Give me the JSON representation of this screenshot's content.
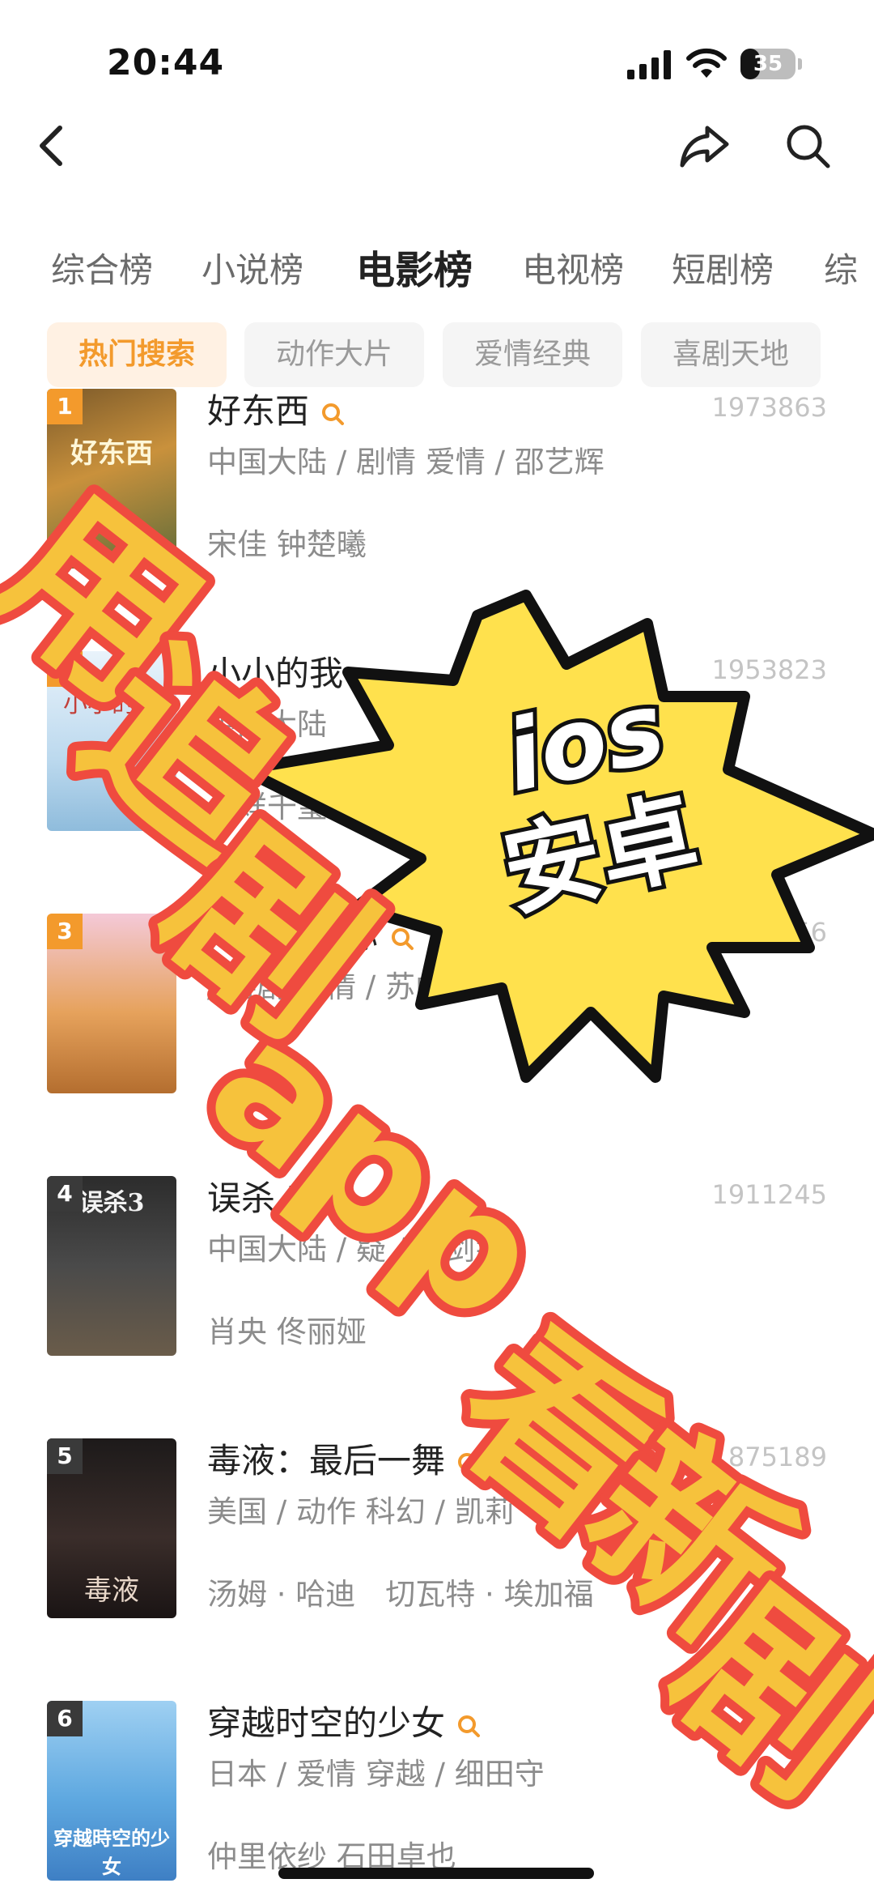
{
  "status_bar": {
    "time": "20:44",
    "battery": "35",
    "battery_level": 0.35
  },
  "nav": {
    "back_icon": "chevron-left-icon",
    "share_icon": "share-icon",
    "search_icon": "search-icon"
  },
  "tabs": [
    {
      "label": "综合榜",
      "active": false
    },
    {
      "label": "小说榜",
      "active": false
    },
    {
      "label": "电影榜",
      "active": true
    },
    {
      "label": "电视榜",
      "active": false
    },
    {
      "label": "短剧榜",
      "active": false
    },
    {
      "label": "综",
      "active": false
    }
  ],
  "chips": [
    {
      "label": "热门搜索",
      "active": true
    },
    {
      "label": "动作大片",
      "active": false
    },
    {
      "label": "爱情经典",
      "active": false
    },
    {
      "label": "喜剧天地",
      "active": false
    }
  ],
  "movies": [
    {
      "rank": "1",
      "title": "好东西",
      "score": "1973863",
      "meta": "中国大陆 / 剧情 爱情 / 邵艺辉",
      "cast": "宋佳 钟楚曦",
      "poster_text": "好东西"
    },
    {
      "rank": "2",
      "title": "小小的我",
      "score": "1953823",
      "meta": "中国大陆",
      "cast": "易烊千玺",
      "poster_text": "小小的我"
    },
    {
      "rank": "3",
      "title": "“骗”喜欢你",
      "score": "556",
      "meta": "/ 喜剧 爱情 / 苏彪",
      "cast": "",
      "poster_text": ""
    },
    {
      "rank": "4",
      "title": "误杀 3",
      "score": "1911245",
      "meta": "中国大陆 / 疑 / 甘剑宇",
      "cast": "肖央 佟丽娅",
      "poster_text": "误杀3"
    },
    {
      "rank": "5",
      "title": "毒液：最后一舞",
      "score": "1875189",
      "meta": "美国 / 动作 科幻 / 凯莉",
      "cast": "汤姆 · 哈迪　切瓦特 · 埃加福",
      "poster_text": "毒液"
    },
    {
      "rank": "6",
      "title": "穿越时空的少女",
      "score": "4594",
      "meta": "日本 / 爱情 穿越 / 细田守",
      "cast": "仲里依纱 石田卓也",
      "poster_text": "穿越時空的少女"
    }
  ],
  "promo": {
    "burst_line1": "ios",
    "burst_line2": "安卓",
    "banner_chars": [
      "用",
      "追",
      "剧",
      "app",
      "看",
      "新",
      "剧"
    ]
  },
  "colors": {
    "accent": "#f39a2c",
    "rank_orange": "#f39a2c",
    "rank_dark": "#3a3a3a",
    "promo_red": "#ef4b3f",
    "promo_yellow": "#ffe14d"
  }
}
